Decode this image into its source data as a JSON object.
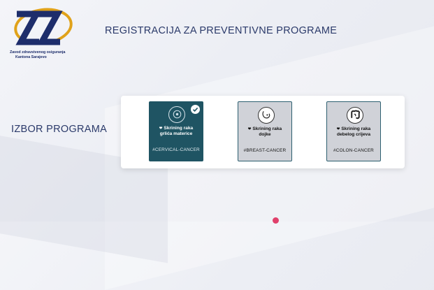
{
  "logo": {
    "mark": "ZZ",
    "lines": [
      "Zavod zdravstvenog osiguranja",
      "Kantona Sarajevo"
    ],
    "colors": {
      "navy": "#1d2d6b",
      "gold": "#e0a21a"
    }
  },
  "header": {
    "title": "REGISTRACIJA ZA PREVENTIVNE PROGRAME"
  },
  "section": {
    "label": "IZBOR PROGRAMA"
  },
  "programs": [
    {
      "name_line1": "Skrining raka",
      "name_line2": "grlića materice",
      "tag": "#CERVICAL-CANCER",
      "selected": true,
      "icon": "cervix-icon"
    },
    {
      "name_line1": "Skrining raka",
      "name_line2": "dojke",
      "tag": "#BREAST-CANCER",
      "selected": false,
      "icon": "breast-icon"
    },
    {
      "name_line1": "Skrining raka",
      "name_line2": "debelog crijeva",
      "tag": "#COLON-CANCER",
      "selected": false,
      "icon": "colon-icon"
    }
  ],
  "colors": {
    "selected_card": "#1f5463",
    "card_border": "#2d5f70",
    "unselected_card": "#d0d2d8",
    "accent_dot": "#e0406b"
  }
}
